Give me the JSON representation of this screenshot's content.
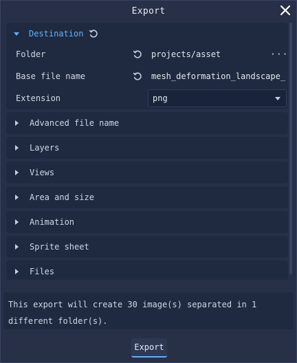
{
  "dialog": {
    "title": "Export",
    "close_icon": "close-icon"
  },
  "sections": {
    "destination": {
      "label": "Destination",
      "expanded": true,
      "folder": {
        "label": "Folder",
        "value": "projects/asset",
        "more": "···"
      },
      "base_file_name": {
        "label": "Base file name",
        "value": "mesh_deformation_landscape_a"
      },
      "extension": {
        "label": "Extension",
        "value": "png"
      }
    },
    "advanced_file_name": {
      "label": "Advanced file name"
    },
    "layers": {
      "label": "Layers"
    },
    "views": {
      "label": "Views"
    },
    "area_and_size": {
      "label": "Area and size"
    },
    "animation": {
      "label": "Animation"
    },
    "sprite_sheet": {
      "label": "Sprite sheet"
    },
    "files": {
      "label": "Files"
    }
  },
  "summary": {
    "text": "This export will create 30 image(s) separated in 1 different folder(s)."
  },
  "footer": {
    "export_label": "Export"
  },
  "colors": {
    "accent": "#5fb2ff",
    "background": "#283047",
    "panel": "#1f2a40"
  }
}
